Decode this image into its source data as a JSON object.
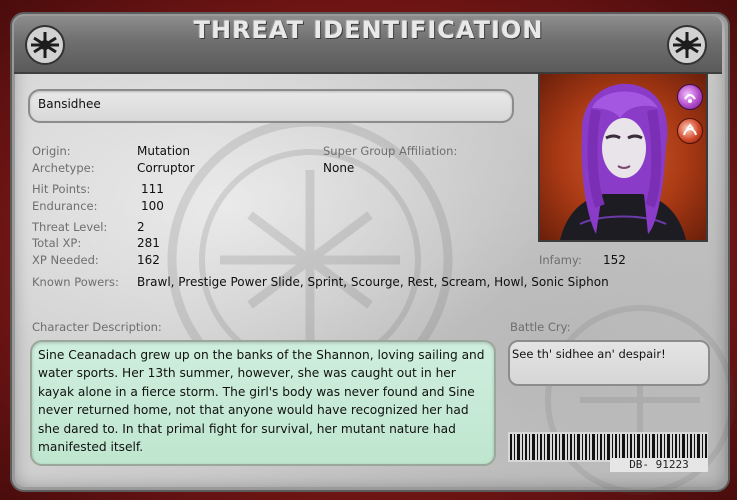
{
  "header": {
    "title": "THREAT IDENTIFICATION",
    "left_emblem_icon": "spider-emblem-icon",
    "right_emblem_icon": "spider-emblem-icon"
  },
  "character": {
    "name": "Bansidhee",
    "origin": {
      "label": "Origin:",
      "value": "Mutation"
    },
    "archetype": {
      "label": "Archetype:",
      "value": "Corruptor"
    },
    "super_group": {
      "label": "Super Group Affiliation:",
      "value": "None"
    },
    "hit_points": {
      "label": "Hit Points:",
      "value": "111"
    },
    "endurance": {
      "label": "Endurance:",
      "value": "100"
    },
    "threat_level": {
      "label": "Threat Level:",
      "value": "2"
    },
    "total_xp": {
      "label": "Total XP:",
      "value": "281"
    },
    "xp_needed": {
      "label": "XP Needed:",
      "value": "162"
    },
    "infamy": {
      "label": "Infamy:",
      "value": "152"
    },
    "known_powers": {
      "label": "Known Powers:",
      "value": "Brawl, Prestige Power Slide, Sprint, Scourge, Rest, Scream, Howl, Sonic Siphon"
    }
  },
  "description": {
    "label": "Character Description:",
    "text": "Sine  Ceanadach  grew up on the banks of the Shannon, loving sailing and water sports.  Her 13th summer, however, she was caught out in her kayak alone in a fierce storm.  The girl's body was never found and Sine never returned home, not that anyone would have recognized her had she dared to.  In that primal fight for survival, her mutant nature had manifested itself."
  },
  "battle_cry": {
    "label": "Battle Cry:",
    "text": "See th' sidhee an' despair!"
  },
  "barcode": {
    "id": "DB- 91223"
  },
  "icons": {
    "origin_icon": "mutation-origin-icon",
    "archetype_icon": "corruptor-archetype-icon"
  },
  "colors": {
    "accent_red": "#7a1a1a",
    "portrait_bg": "#b23c16",
    "desc_bg": "#c8ead7",
    "hair_purple": "#8a3cc8"
  }
}
